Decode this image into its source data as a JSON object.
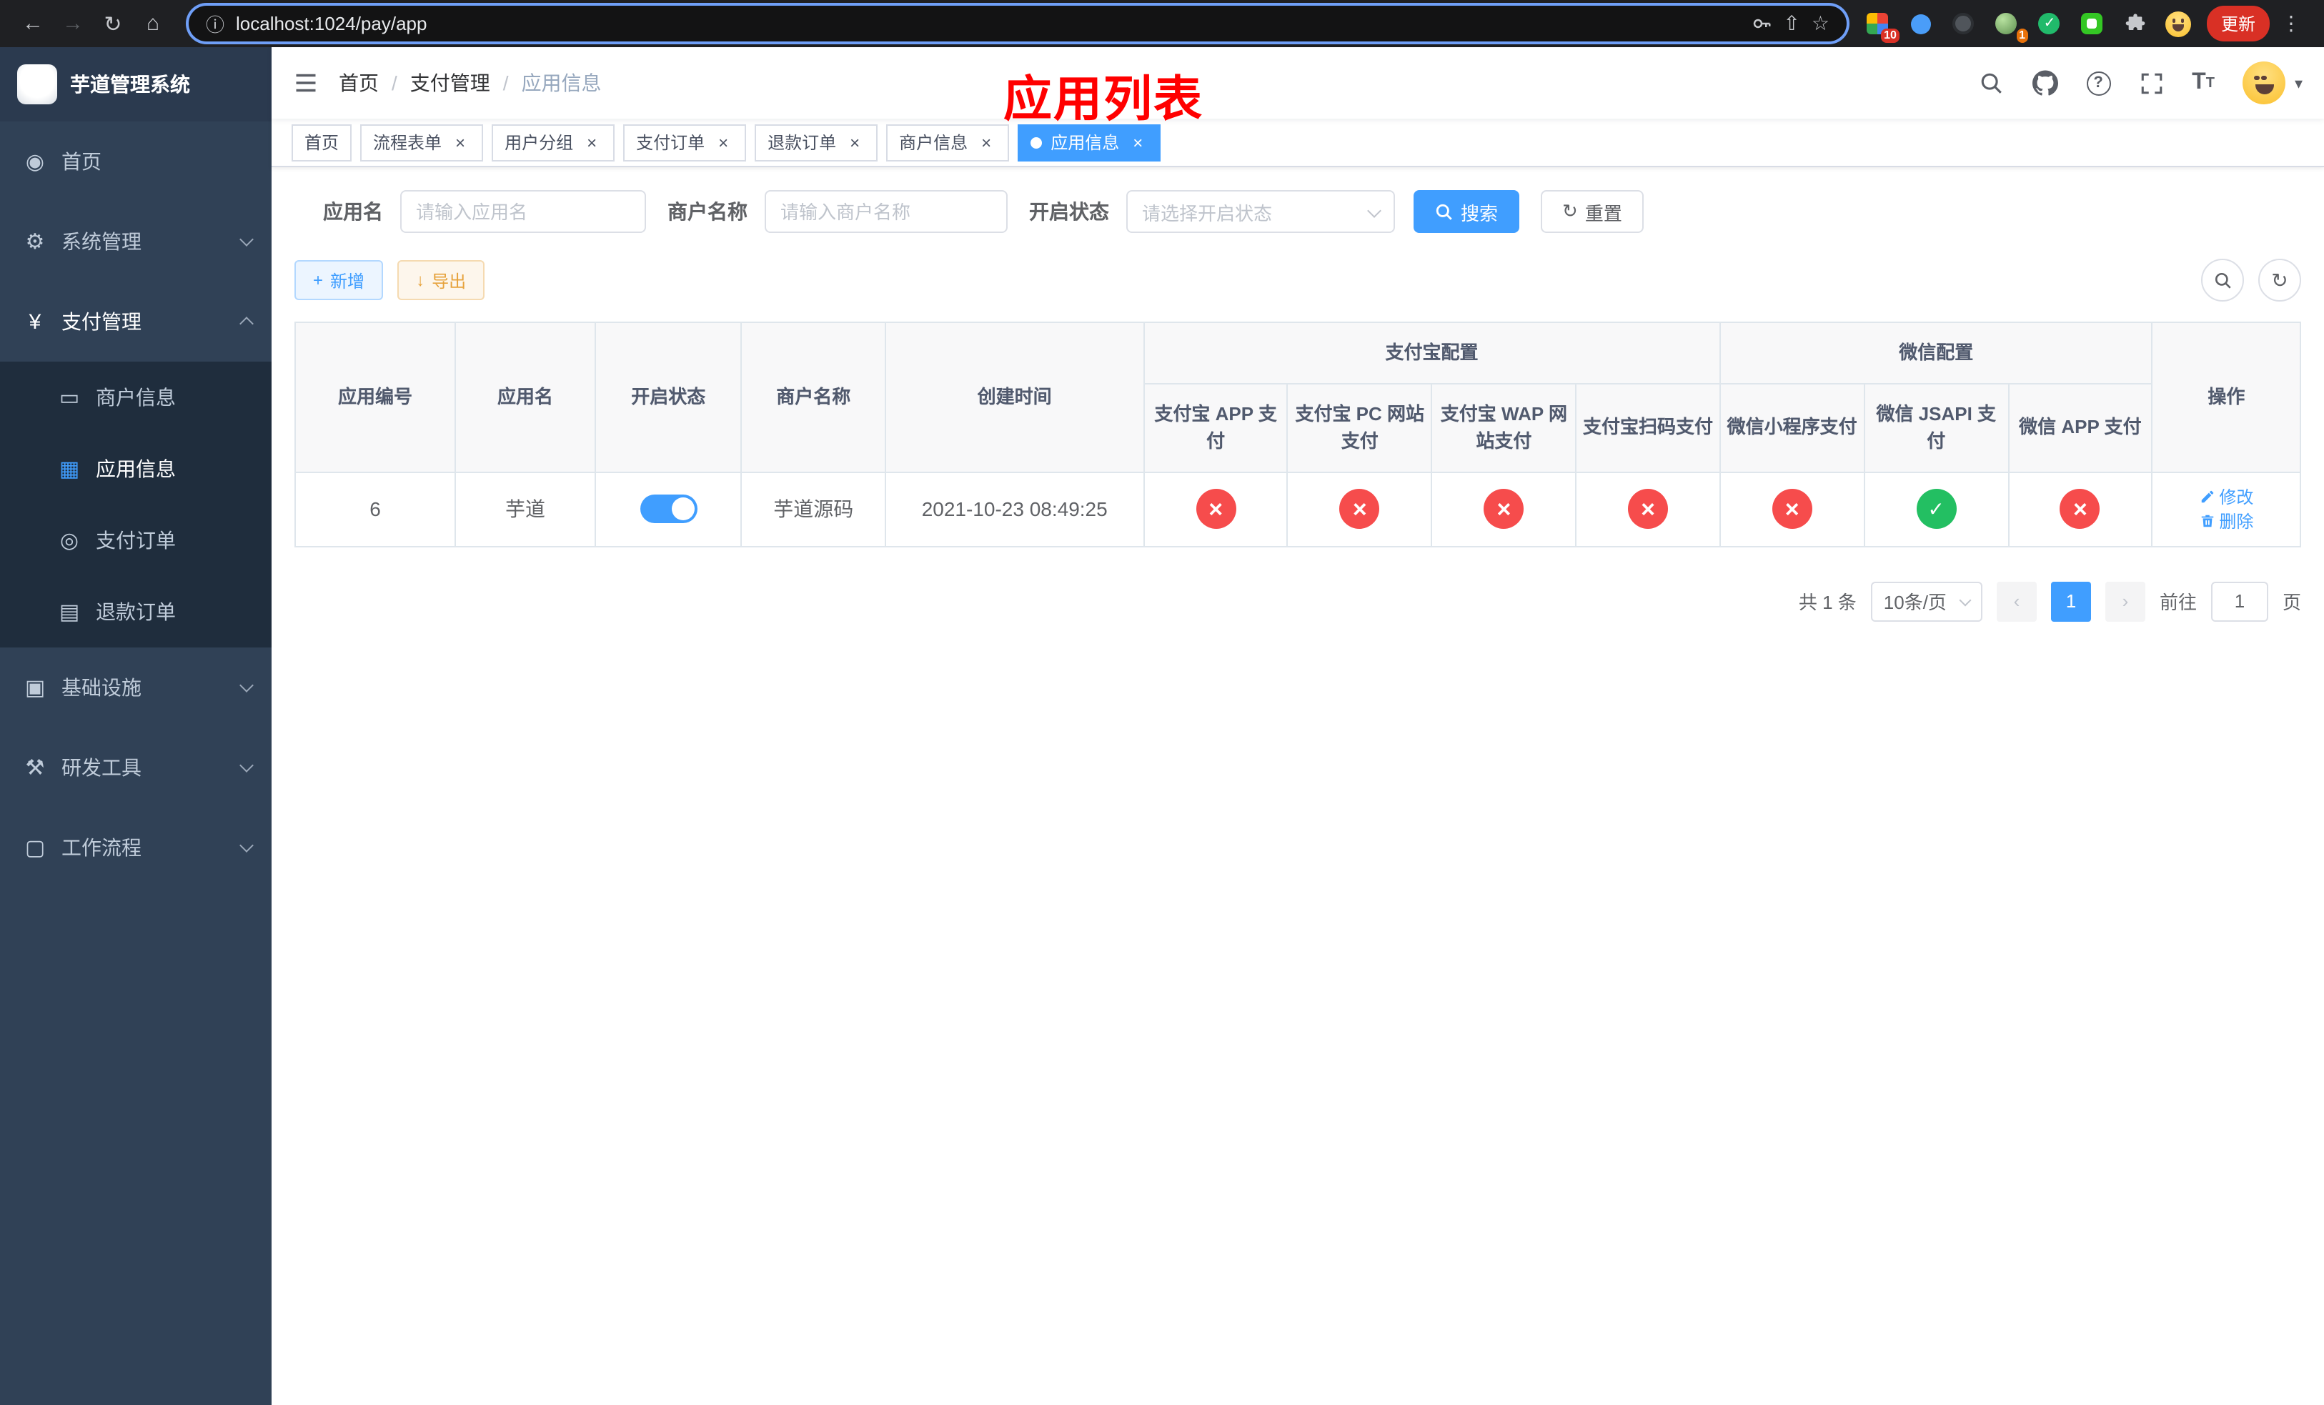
{
  "page_overlay_title": "应用列表",
  "browser": {
    "url": "localhost:1024/pay/app",
    "update_label": "更新",
    "ext_badge_10": "10",
    "ext_badge_1": "1"
  },
  "icons": {
    "back": "←",
    "forward": "→",
    "reload": "↻",
    "home": "⌂",
    "info": "ⓘ",
    "share": "⇧",
    "star": "☆",
    "dots": "⋮",
    "dashboard": "◉",
    "gear": "⚙",
    "yen": "¥",
    "card": "▭",
    "grid": "▦",
    "order": "◎",
    "refund": "▤",
    "infra": "▣",
    "tools": "⚒",
    "workflow": "▢",
    "plus": "+",
    "download": "↓",
    "refresh": "↻",
    "prev": "‹",
    "next": "›",
    "caret": "▾",
    "text_size": "T"
  },
  "sidebar": {
    "title": "芋道管理系统",
    "items": [
      {
        "label": "首页"
      },
      {
        "label": "系统管理",
        "expandable": true
      },
      {
        "label": "支付管理",
        "expandable": true,
        "expanded": true,
        "children": [
          {
            "label": "商户信息",
            "active": false
          },
          {
            "label": "应用信息",
            "active": true
          },
          {
            "label": "支付订单",
            "active": false
          },
          {
            "label": "退款订单",
            "active": false
          }
        ]
      },
      {
        "label": "基础设施",
        "expandable": true
      },
      {
        "label": "研发工具",
        "expandable": true
      },
      {
        "label": "工作流程",
        "expandable": true
      }
    ]
  },
  "breadcrumb": {
    "separator": "/",
    "items": [
      "首页",
      "支付管理",
      "应用信息"
    ]
  },
  "tabs": [
    {
      "label": "首页",
      "closable": false,
      "active": false
    },
    {
      "label": "流程表单",
      "closable": true,
      "active": false
    },
    {
      "label": "用户分组",
      "closable": true,
      "active": false
    },
    {
      "label": "支付订单",
      "closable": true,
      "active": false
    },
    {
      "label": "退款订单",
      "closable": true,
      "active": false
    },
    {
      "label": "商户信息",
      "closable": true,
      "active": false
    },
    {
      "label": "应用信息",
      "closable": true,
      "active": true
    }
  ],
  "filters": {
    "app_name_label": "应用名",
    "app_name_placeholder": "请输入应用名",
    "merchant_label": "商户名称",
    "merchant_placeholder": "请输入商户名称",
    "status_label": "开启状态",
    "status_placeholder": "请选择开启状态",
    "search_label": "搜索",
    "reset_label": "重置"
  },
  "toolbar": {
    "add_label": "新增",
    "export_label": "导出"
  },
  "table": {
    "headers": {
      "app_id": "应用编号",
      "app_name": "应用名",
      "status": "开启状态",
      "merchant_name": "商户名称",
      "create_time": "创建时间",
      "alipay_group": "支付宝配置",
      "wechat_group": "微信配置",
      "alipay_app": "支付宝 APP 支付",
      "alipay_pc": "支付宝 PC 网站支付",
      "alipay_wap": "支付宝 WAP 网站支付",
      "alipay_qr": "支付宝扫码支付",
      "wx_mini": "微信小程序支付",
      "wx_jsapi": "微信 JSAPI 支付",
      "wx_app": "微信 APP 支付",
      "actions": "操作"
    },
    "rows": [
      {
        "app_id": "6",
        "app_name": "芋道",
        "enabled": true,
        "merchant_name": "芋道源码",
        "create_time": "2021-10-23 08:49:25",
        "configs": {
          "alipay_app": false,
          "alipay_pc": false,
          "alipay_wap": false,
          "alipay_qr": false,
          "wx_mini": false,
          "wx_jsapi": true,
          "wx_app": false
        },
        "actions": {
          "edit": "修改",
          "delete": "删除"
        }
      }
    ]
  },
  "pagination": {
    "total": "共 1 条",
    "page_size": "10条/页",
    "page": "1",
    "goto_label": "前往",
    "goto_page": "1",
    "page_unit": "页"
  }
}
